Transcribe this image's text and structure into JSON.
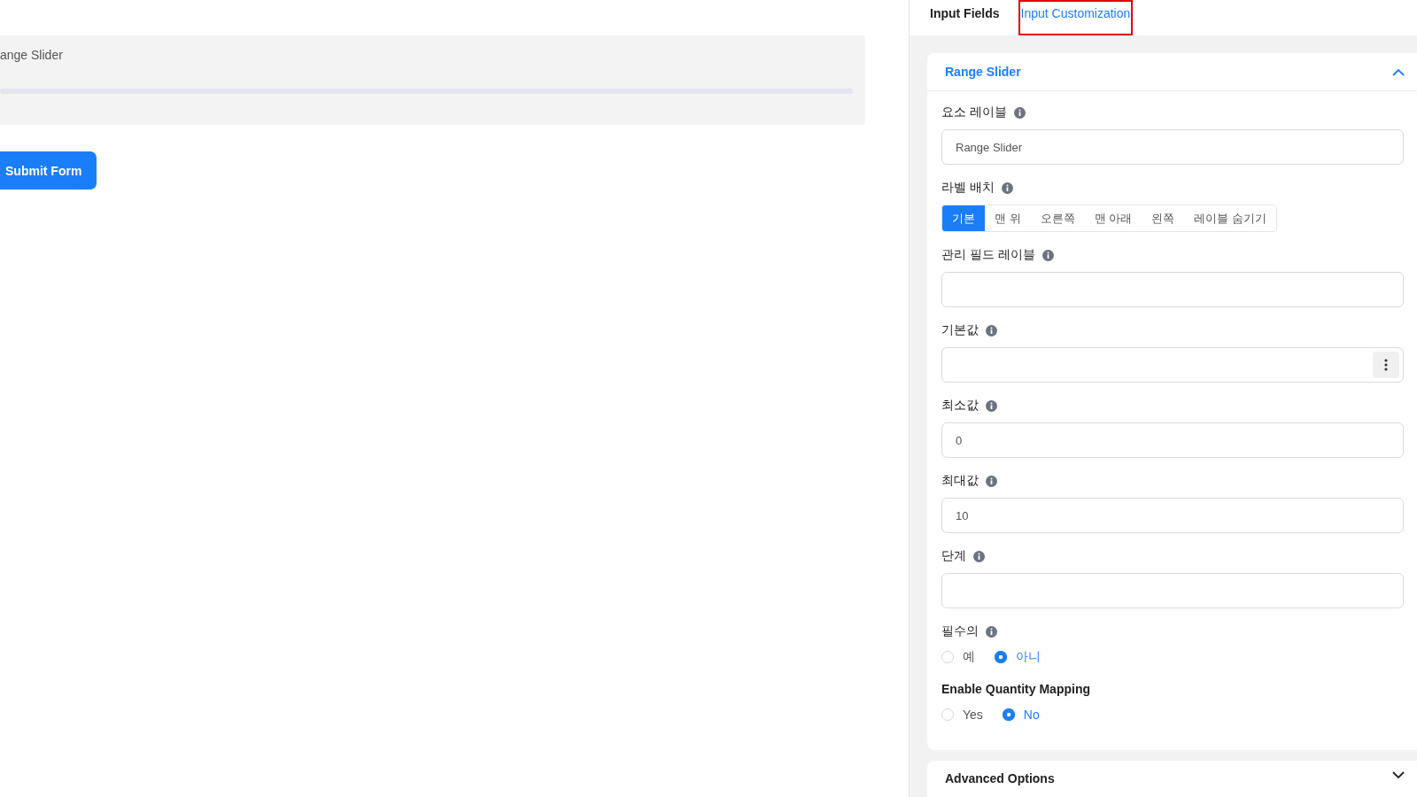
{
  "preview": {
    "field_label": "ange Slider",
    "submit_button": "Submit Form"
  },
  "tabs": [
    {
      "label": "Input Fields",
      "selected": false,
      "highlighted": false
    },
    {
      "label": "Input Customization",
      "selected": true,
      "highlighted": true
    }
  ],
  "panel": {
    "title": "Range Slider",
    "expanded": true,
    "fields": [
      {
        "kind": "text",
        "label": "요소 레이블",
        "bold": false,
        "info": true,
        "value": "Range Slider"
      },
      {
        "kind": "segmented",
        "label": "라벨 배치",
        "bold": false,
        "info": true,
        "options": [
          {
            "label": "기본",
            "selected": true
          },
          {
            "label": "맨 위",
            "selected": false
          },
          {
            "label": "오른쪽",
            "selected": false
          },
          {
            "label": "맨 아래",
            "selected": false
          },
          {
            "label": "왼쪽",
            "selected": false
          },
          {
            "label": "레이블 숨기기",
            "selected": false
          }
        ]
      },
      {
        "kind": "text",
        "label": "관리 필드 레이블",
        "bold": false,
        "info": true
      },
      {
        "kind": "menu-text",
        "label": "기본값",
        "bold": false,
        "info": true
      },
      {
        "kind": "text",
        "label": "최소값",
        "bold": false,
        "info": true,
        "value": "0"
      },
      {
        "kind": "text",
        "label": "최대값",
        "bold": false,
        "info": true,
        "value": "10"
      },
      {
        "kind": "text",
        "label": "단계",
        "bold": false,
        "info": true
      },
      {
        "kind": "radio",
        "label": "필수의",
        "bold": false,
        "info": true,
        "options": [
          {
            "label": "예",
            "selected": false
          },
          {
            "label": "아니",
            "selected": true
          }
        ]
      },
      {
        "kind": "radio",
        "label": "Enable Quantity Mapping",
        "bold": true,
        "info": false,
        "options": [
          {
            "label": "Yes",
            "selected": false
          },
          {
            "label": "No",
            "selected": true
          }
        ]
      }
    ]
  },
  "advanced": {
    "title": "Advanced Options",
    "expanded": false
  }
}
